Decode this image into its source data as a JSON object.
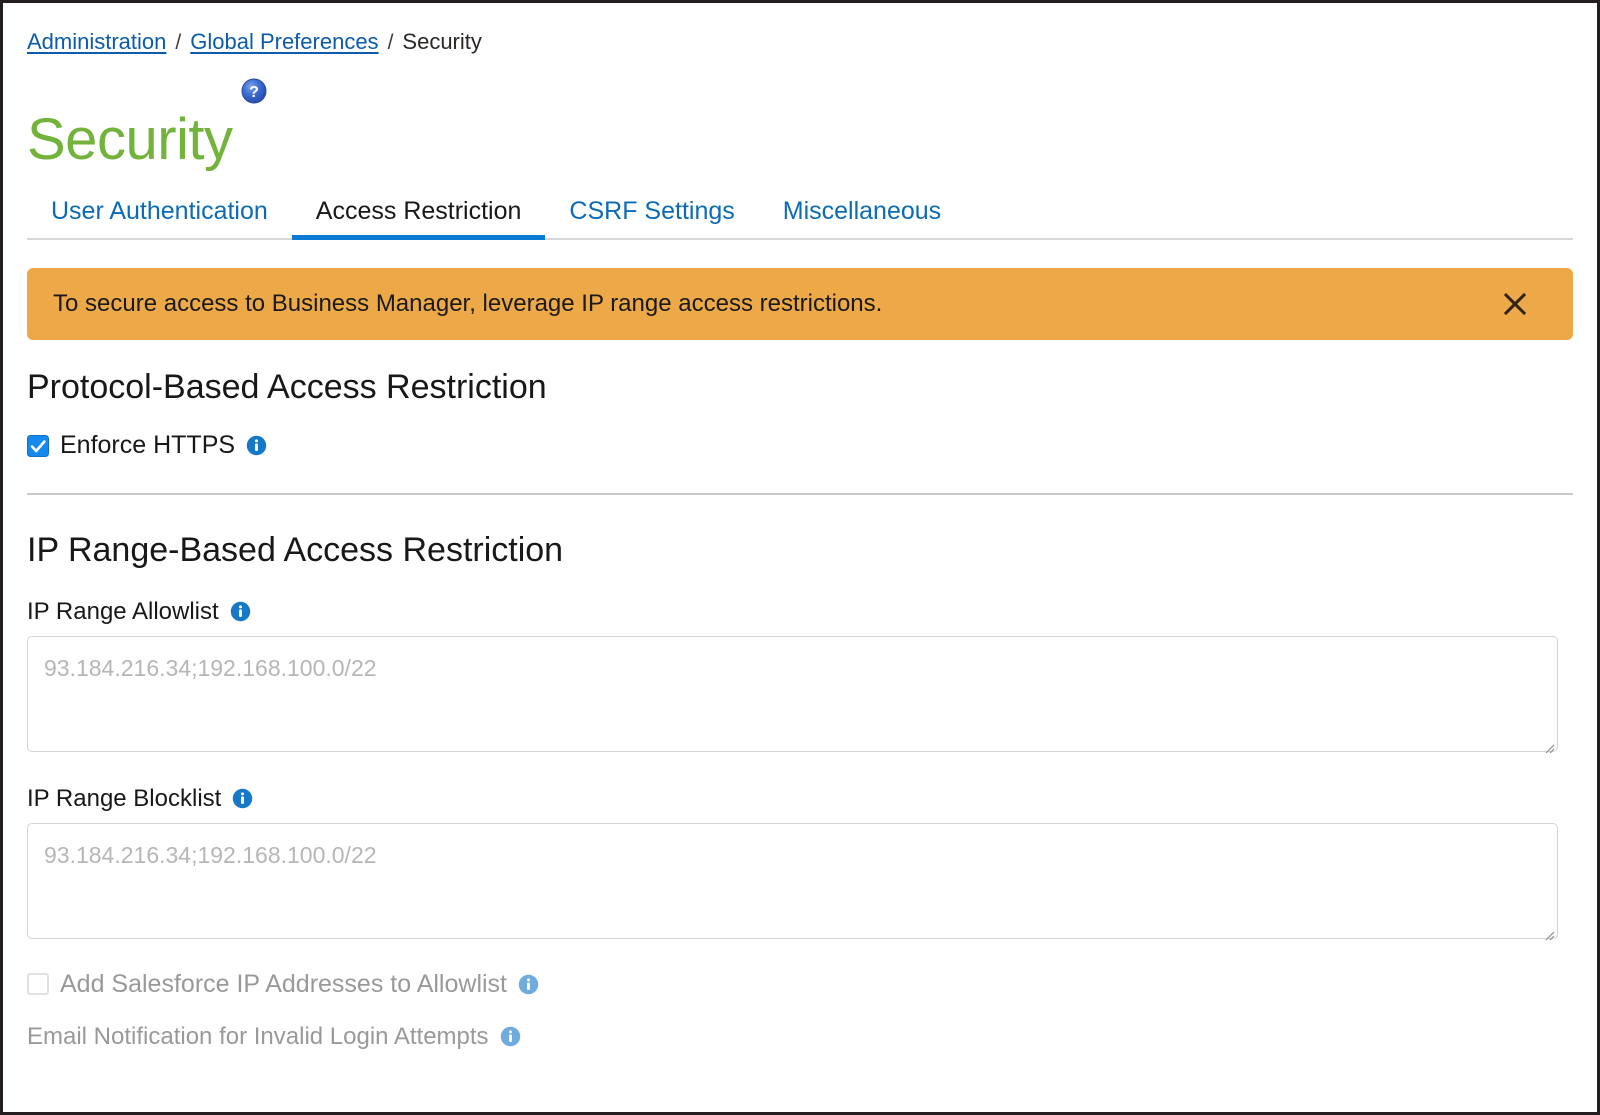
{
  "breadcrumb": {
    "items": [
      {
        "label": "Administration",
        "link": true
      },
      {
        "label": "Global Preferences",
        "link": true
      },
      {
        "label": "Security",
        "link": false
      }
    ],
    "separator": "/"
  },
  "header": {
    "title": "Security",
    "title_color": "#73b23b",
    "help_icon": "help-question-icon"
  },
  "tabs": [
    {
      "label": "User Authentication",
      "active": false
    },
    {
      "label": "Access Restriction",
      "active": true
    },
    {
      "label": "CSRF Settings",
      "active": false
    },
    {
      "label": "Miscellaneous",
      "active": false
    }
  ],
  "banner": {
    "message": "To secure access to Business Manager, leverage IP range access restrictions.",
    "background": "#eda848",
    "close_icon": "close-x-icon"
  },
  "protocol_section": {
    "heading": "Protocol-Based Access Restriction",
    "enforce_https": {
      "label": "Enforce HTTPS",
      "checked": true,
      "info_icon": "info-circle-icon"
    }
  },
  "ip_section": {
    "heading": "IP Range-Based Access Restriction",
    "allowlist": {
      "label": "IP Range Allowlist",
      "value": "",
      "placeholder": "93.184.216.34;192.168.100.0/22",
      "info_icon": "info-circle-icon"
    },
    "blocklist": {
      "label": "IP Range Blocklist",
      "value": "",
      "placeholder": "93.184.216.34;192.168.100.0/22",
      "info_icon": "info-circle-icon"
    },
    "add_salesforce_ips": {
      "label": "Add Salesforce IP Addresses to Allowlist",
      "checked": false,
      "info_icon": "info-circle-icon"
    },
    "email_notification": {
      "label": "Email Notification for Invalid Login Attempts",
      "info_icon": "info-circle-icon"
    }
  },
  "colors": {
    "accent_blue": "#0b7ad4",
    "link_blue": "#0b5cab",
    "brand_green": "#73b23b",
    "warning_orange": "#eda848"
  }
}
